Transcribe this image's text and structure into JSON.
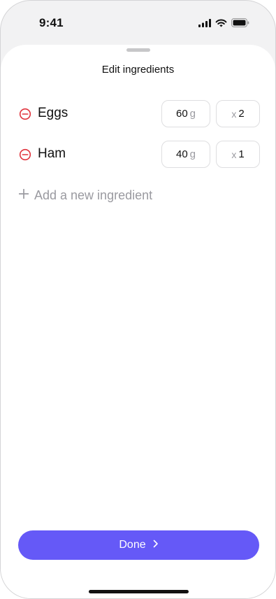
{
  "status_bar": {
    "time": "9:41",
    "icons": [
      "cellular-signal-icon",
      "wifi-icon",
      "battery-icon"
    ]
  },
  "sheet": {
    "title": "Edit ingredients"
  },
  "ingredients": [
    {
      "name": "Eggs",
      "weight": "60",
      "weight_unit": "g",
      "multiplier_symbol": "x",
      "quantity": "2"
    },
    {
      "name": "Ham",
      "weight": "40",
      "weight_unit": "g",
      "multiplier_symbol": "x",
      "quantity": "1"
    }
  ],
  "add_ingredient": {
    "label": "Add a new ingredient"
  },
  "done_button": {
    "label": "Done"
  },
  "colors": {
    "accent": "#6559f7",
    "remove": "#e0323c",
    "muted_text": "#9a9aa0",
    "field_border": "#dedee0"
  }
}
